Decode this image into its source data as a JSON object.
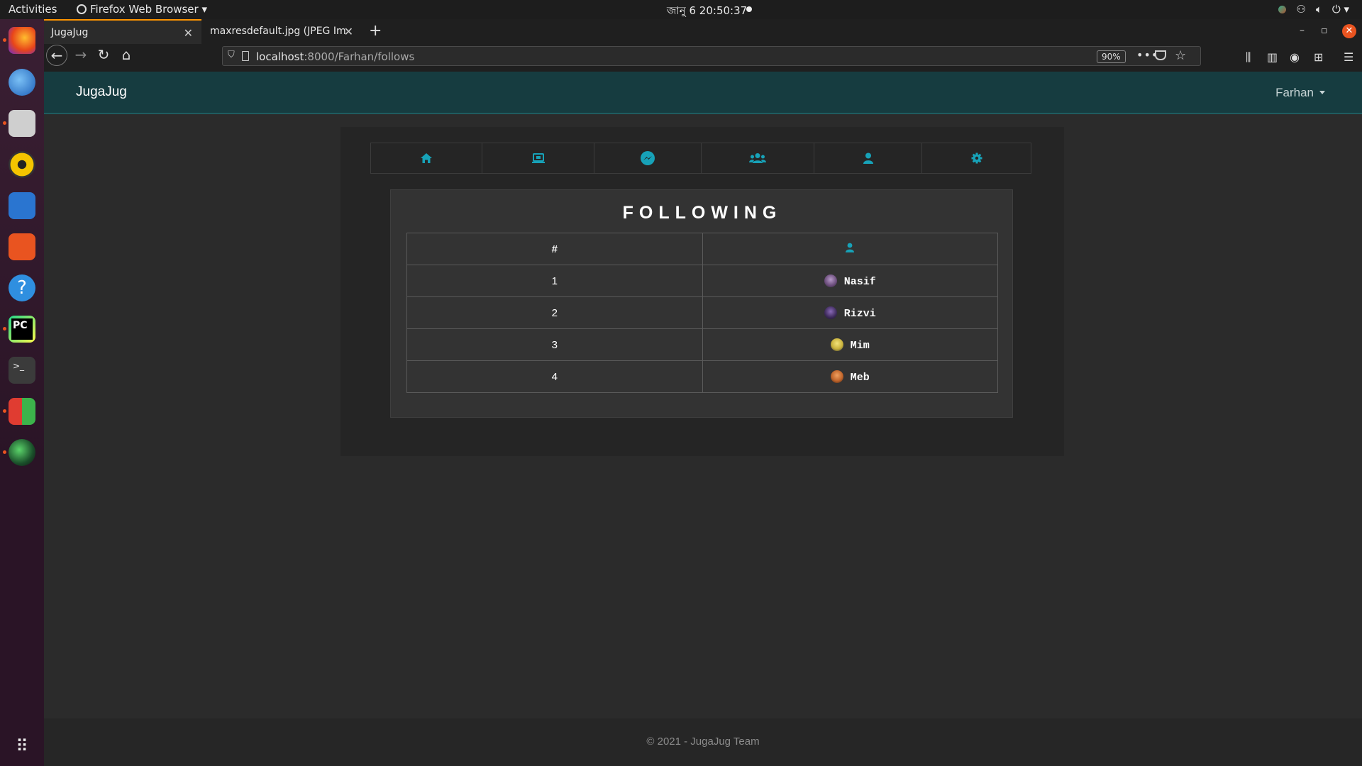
{
  "desktop": {
    "activities": "Activities",
    "app_name": "Firefox Web Browser",
    "clock": "জানু 6  20:50:37"
  },
  "browser": {
    "tabs": [
      {
        "label": "JugaJug"
      },
      {
        "label": "maxresdefault.jpg (JPEG Im"
      }
    ],
    "url_host": "localhost",
    "url_rest": ":8000/Farhan/follows",
    "zoom": "90%"
  },
  "site": {
    "brand": "JugaJug",
    "user_menu": "Farhan",
    "accent_color": "#17a2b8",
    "nav_icons": [
      "home-icon",
      "laptop-icon",
      "messenger-icon",
      "users-icon",
      "user-icon",
      "gear-icon"
    ],
    "following": {
      "title": "FOLLOWING",
      "col_index": "#",
      "col_user_icon": "user-icon",
      "rows": [
        {
          "index": "1",
          "name": "Nasif",
          "avatar_color": "#6a4c7a"
        },
        {
          "index": "2",
          "name": "Rizvi",
          "avatar_color": "#3d2a5a"
        },
        {
          "index": "3",
          "name": "Mim",
          "avatar_color": "#c9b23c"
        },
        {
          "index": "4",
          "name": "Meb",
          "avatar_color": "#c0652b"
        }
      ]
    },
    "footer": "© 2021 - JugaJug Team"
  }
}
